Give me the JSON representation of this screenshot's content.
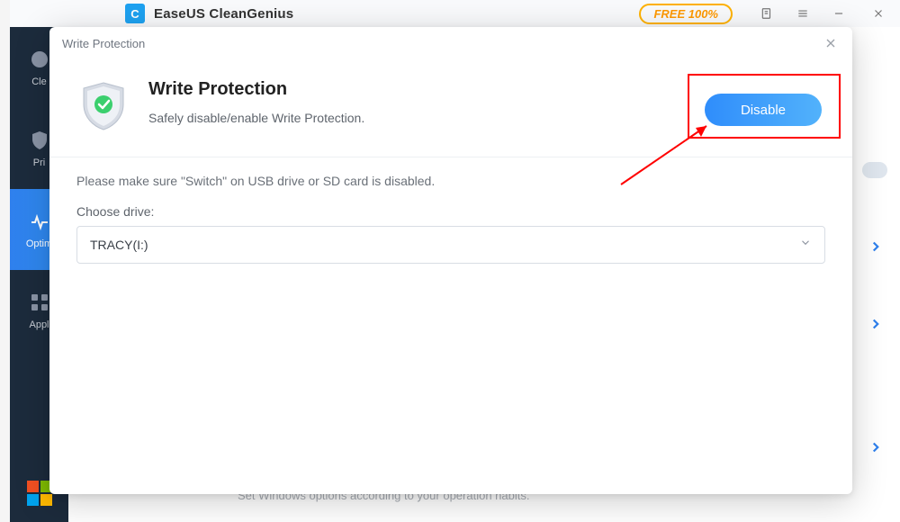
{
  "app": {
    "title": "EaseUS CleanGenius",
    "free_badge": "FREE 100%"
  },
  "sidebar": {
    "items": [
      {
        "label": "Cle"
      },
      {
        "label": "Pri"
      },
      {
        "label": "Optim"
      },
      {
        "label": "Appl"
      }
    ]
  },
  "main_bg_text": "Set Windows options according to your operation habits.",
  "modal": {
    "window_title": "Write Protection",
    "heading": "Write Protection",
    "subheading": "Safely disable/enable Write Protection.",
    "button_label": "Disable",
    "instruction": "Please make sure \"Switch\" on USB drive or SD card is disabled.",
    "choose_label": "Choose drive:",
    "selected_drive": "TRACY(I:)"
  }
}
